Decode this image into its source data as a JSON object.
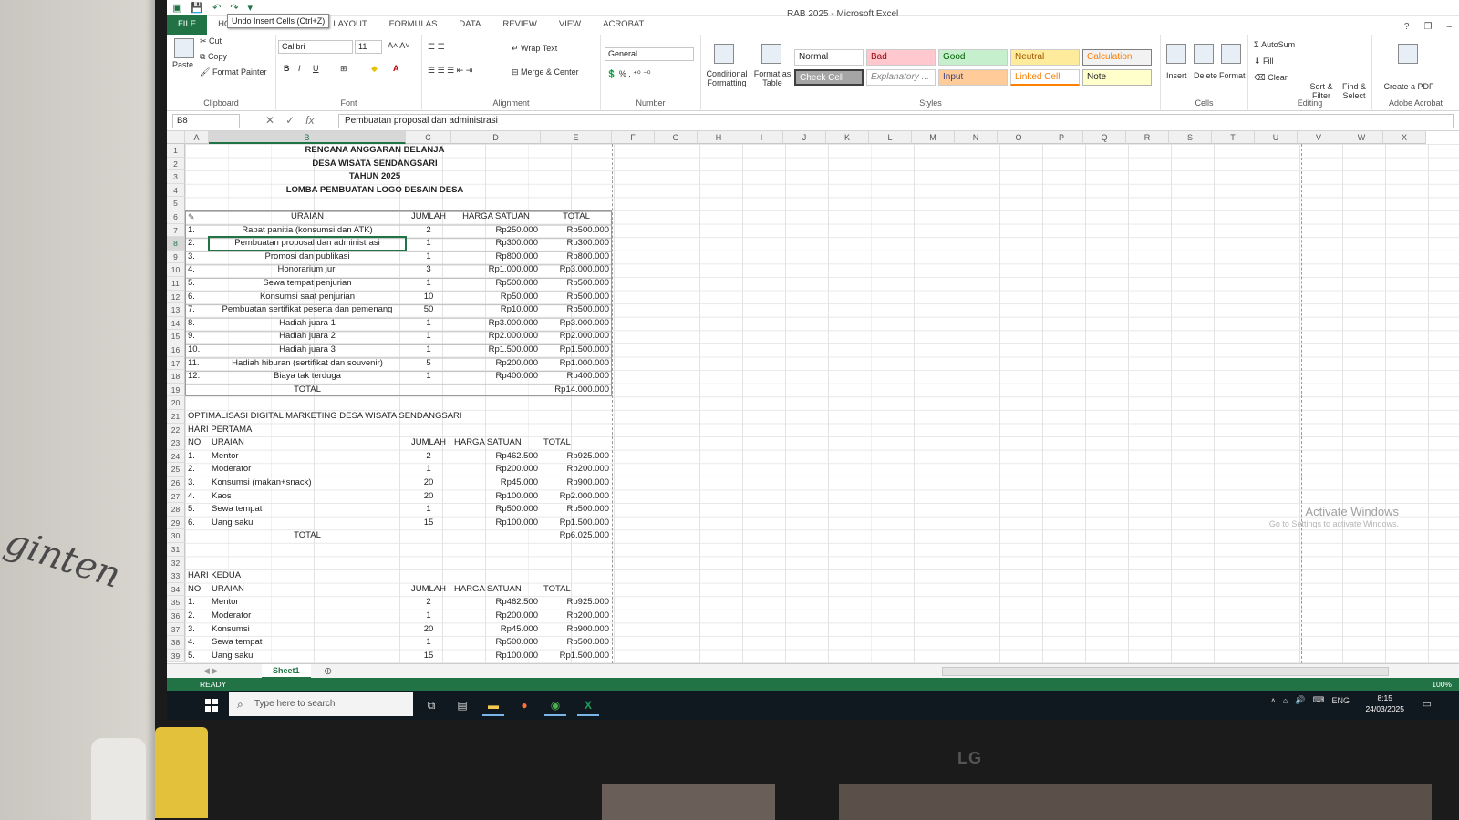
{
  "app": {
    "title": "RAB 2025 - Microsoft Excel",
    "tooltip": "Undo Insert Cells (Ctrl+Z)"
  },
  "ribbon": {
    "tabs": [
      "FILE",
      "HO",
      "LAYOUT",
      "FORMULAS",
      "DATA",
      "REVIEW",
      "VIEW",
      "ACROBAT"
    ],
    "clipboard": {
      "cut": "Cut",
      "copy": "Copy",
      "format_painter": "Format Painter",
      "paste": "Paste",
      "label": "Clipboard"
    },
    "font": {
      "name": "Calibri",
      "size": "11",
      "label": "Font"
    },
    "alignment": {
      "wrap": "Wrap Text",
      "merge": "Merge & Center",
      "label": "Alignment"
    },
    "number": {
      "format": "General",
      "label": "Number"
    },
    "styles": {
      "conditional": "Conditional Formatting",
      "format_table": "Format as Table",
      "label": "Styles",
      "cells": [
        "Normal",
        "Bad",
        "Good",
        "Neutral",
        "Calculation",
        "Check Cell",
        "Explanatory ...",
        "Input",
        "Linked Cell",
        "Note"
      ]
    },
    "cells": {
      "insert": "Insert",
      "delete": "Delete",
      "format": "Format",
      "label": "Cells"
    },
    "editing": {
      "autosum": "AutoSum",
      "fill": "Fill",
      "clear": "Clear",
      "sort": "Sort & Filter",
      "find": "Find & Select",
      "label": "Editing"
    },
    "adobe": {
      "create": "Create a PDF",
      "label": "Adobe Acrobat"
    }
  },
  "formula_bar": {
    "name_box": "B8",
    "content": "Pembuatan proposal dan administrasi"
  },
  "columns": [
    "A",
    "B",
    "C",
    "D",
    "E",
    "F",
    "G",
    "H",
    "I",
    "J",
    "K",
    "L",
    "M",
    "N",
    "O",
    "P",
    "Q",
    "R",
    "S",
    "T",
    "U",
    "V",
    "W",
    "X"
  ],
  "rows": [
    "1",
    "2",
    "3",
    "4",
    "5",
    "6",
    "7",
    "8",
    "9",
    "10",
    "11",
    "12",
    "13",
    "14",
    "15",
    "16",
    "17",
    "18",
    "19",
    "20",
    "21",
    "22",
    "23",
    "24",
    "25",
    "26",
    "27",
    "28",
    "29",
    "30",
    "31",
    "32",
    "33",
    "34",
    "35",
    "36",
    "37",
    "38",
    "39"
  ],
  "sheet": {
    "title_lines": [
      "RENCANA ANGGARAN BELANJA",
      "DESA WISATA SENDANGSARI",
      "TAHUN 2025",
      "LOMBA PEMBUATAN LOGO DESAIN DESA"
    ],
    "headers": {
      "uraian": "URAIAN",
      "jumlah": "JUMLAH",
      "harga": "HARGA SATUAN",
      "total": "TOTAL"
    },
    "table1": [
      {
        "no": "1.",
        "item": "Rapat panitia (konsumsi dan ATK)",
        "qty": "2",
        "price": "Rp250.000",
        "total": "Rp500.000"
      },
      {
        "no": "2.",
        "item": "Pembuatan proposal dan administrasi",
        "qty": "1",
        "price": "Rp300.000",
        "total": "Rp300.000"
      },
      {
        "no": "3.",
        "item": "Promosi dan publikasi",
        "qty": "1",
        "price": "Rp800.000",
        "total": "Rp800.000"
      },
      {
        "no": "4.",
        "item": "Honorarium juri",
        "qty": "3",
        "price": "Rp1.000.000",
        "total": "Rp3.000.000"
      },
      {
        "no": "5.",
        "item": "Sewa tempat penjurian",
        "qty": "1",
        "price": "Rp500.000",
        "total": "Rp500.000"
      },
      {
        "no": "6.",
        "item": "Konsumsi saat penjurian",
        "qty": "10",
        "price": "Rp50.000",
        "total": "Rp500.000"
      },
      {
        "no": "7.",
        "item": "Pembuatan sertifikat peserta dan pemenang",
        "qty": "50",
        "price": "Rp10.000",
        "total": "Rp500.000"
      },
      {
        "no": "8.",
        "item": "Hadiah juara 1",
        "qty": "1",
        "price": "Rp3.000.000",
        "total": "Rp3.000.000"
      },
      {
        "no": "9.",
        "item": "Hadiah juara 2",
        "qty": "1",
        "price": "Rp2.000.000",
        "total": "Rp2.000.000"
      },
      {
        "no": "10.",
        "item": "Hadiah juara 3",
        "qty": "1",
        "price": "Rp1.500.000",
        "total": "Rp1.500.000"
      },
      {
        "no": "11.",
        "item": "Hadiah hiburan (sertifikat dan souvenir)",
        "qty": "5",
        "price": "Rp200.000",
        "total": "Rp1.000.000"
      },
      {
        "no": "12.",
        "item": "Biaya tak terduga",
        "qty": "1",
        "price": "Rp400.000",
        "total": "Rp400.000"
      }
    ],
    "table1_total_label": "TOTAL",
    "table1_total": "Rp14.000.000",
    "section2_title": "OPTIMALISASI DIGITAL MARKETING DESA WISATA SENDANGSARI",
    "day1_label": "HARI PERTAMA",
    "no_label": "NO.",
    "table2": [
      {
        "no": "1.",
        "item": "Mentor",
        "qty": "2",
        "price": "Rp462.500",
        "total": "Rp925.000"
      },
      {
        "no": "2.",
        "item": "Moderator",
        "qty": "1",
        "price": "Rp200.000",
        "total": "Rp200.000"
      },
      {
        "no": "3.",
        "item": "Konsumsi (makan+snack)",
        "qty": "20",
        "price": "Rp45.000",
        "total": "Rp900.000"
      },
      {
        "no": "4.",
        "item": "Kaos",
        "qty": "20",
        "price": "Rp100.000",
        "total": "Rp2.000.000"
      },
      {
        "no": "5.",
        "item": "Sewa tempat",
        "qty": "1",
        "price": "Rp500.000",
        "total": "Rp500.000"
      },
      {
        "no": "6.",
        "item": "Uang saku",
        "qty": "15",
        "price": "Rp100.000",
        "total": "Rp1.500.000"
      }
    ],
    "table2_total_label": "TOTAL",
    "table2_total": "Rp6.025.000",
    "day2_label": "HARI KEDUA",
    "table3": [
      {
        "no": "1.",
        "item": "Mentor",
        "qty": "2",
        "price": "Rp462.500",
        "total": "Rp925.000"
      },
      {
        "no": "2.",
        "item": "Moderator",
        "qty": "1",
        "price": "Rp200.000",
        "total": "Rp200.000"
      },
      {
        "no": "3.",
        "item": "Konsumsi",
        "qty": "20",
        "price": "Rp45.000",
        "total": "Rp900.000"
      },
      {
        "no": "4.",
        "item": "Sewa tempat",
        "qty": "1",
        "price": "Rp500.000",
        "total": "Rp500.000"
      },
      {
        "no": "5.",
        "item": "Uang saku",
        "qty": "15",
        "price": "Rp100.000",
        "total": "Rp1.500.000"
      }
    ]
  },
  "watermark": {
    "line1": "Activate Windows",
    "line2": "Go to Settings to activate Windows."
  },
  "sheet_tab": "Sheet1",
  "status": {
    "ready": "READY",
    "zoom": "100%"
  },
  "taskbar": {
    "search_placeholder": "Type here to search",
    "lang": "ENG",
    "time": "8:15",
    "date": "24/03/2025"
  },
  "monitor": {
    "brand": "LG"
  },
  "wall_text": "ginten",
  "colors": {
    "excel_green": "#217346",
    "taskbar": "#101820"
  }
}
